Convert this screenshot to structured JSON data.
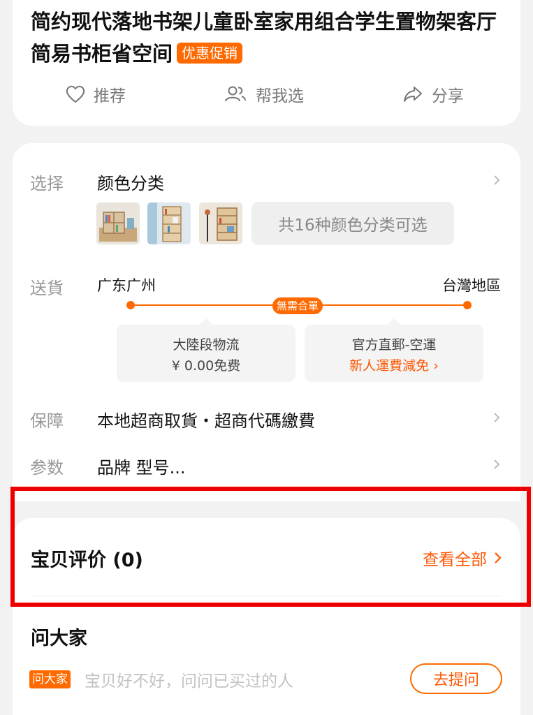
{
  "product": {
    "title": "简约现代落地书架儿童卧室家用组合学生置物架客厅简易书柜省空间",
    "promo_badge": "优惠促销"
  },
  "actions": [
    {
      "label": "推荐",
      "icon": "heart-icon"
    },
    {
      "label": "帮我选",
      "icon": "users-icon"
    },
    {
      "label": "分享",
      "icon": "share-icon"
    }
  ],
  "options": {
    "select_label": "选择",
    "select_value": "颜色分类",
    "color_count_text": "共16种颜色分类可选"
  },
  "shipping": {
    "label": "送貨",
    "from": "广东广州",
    "to": "台灣地區",
    "badge": "無需合單",
    "segment1_title": "大陸段物流",
    "segment1_fee": "¥ 0.00免费",
    "segment2_title": "官方直郵-空運",
    "segment2_promo": "新人運費減免 ›"
  },
  "guarantee": {
    "label": "保障",
    "value": "本地超商取貨・超商代碼繳費"
  },
  "params": {
    "label": "参数",
    "value": "品牌 型号..."
  },
  "reviews": {
    "title": "宝贝评价 (0)",
    "view_all": "查看全部"
  },
  "ask": {
    "title": "问大家",
    "badge": "问大家",
    "placeholder": "宝贝好不好，问问已买过的人",
    "button": "去提问"
  },
  "colors": {
    "accent": "#ff6a00",
    "accent_text": "#ff5500",
    "highlight": "#ee0000"
  }
}
